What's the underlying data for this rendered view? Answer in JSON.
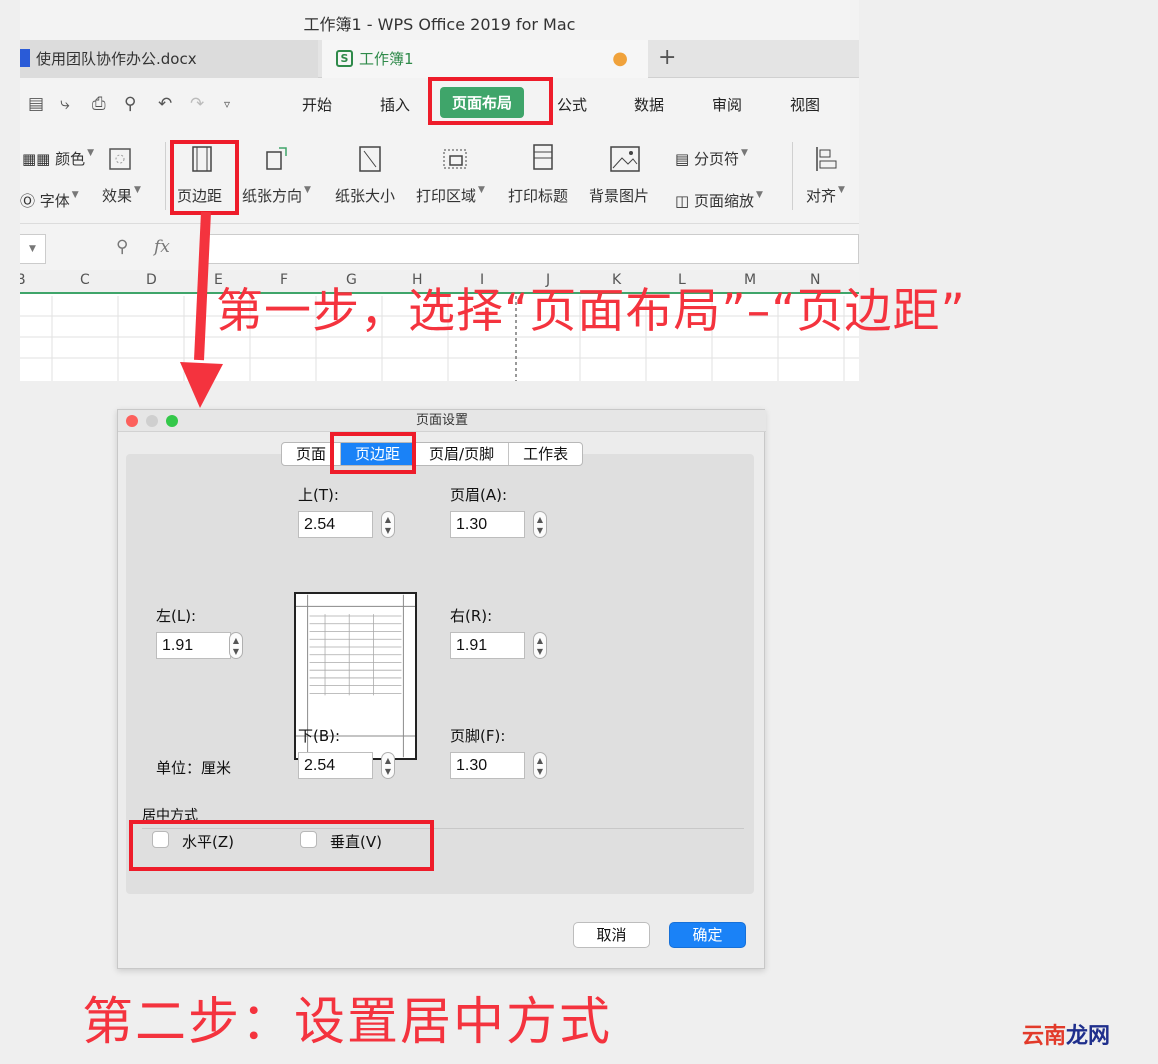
{
  "window": {
    "title": "工作簿1 - WPS Office 2019 for Mac",
    "tabs": [
      {
        "label": "使用团队协作办公.docx"
      },
      {
        "label": "工作簿1",
        "icon": "S",
        "modified_dot": "●"
      }
    ],
    "new_tab": "+"
  },
  "menu": {
    "items": [
      "开始",
      "插入",
      "页面布局",
      "公式",
      "数据",
      "审阅",
      "视图"
    ],
    "active": "页面布局"
  },
  "ribbon": {
    "color": "颜色",
    "font": "字体",
    "effect": "效果",
    "margins": "页边距",
    "orientation": "纸张方向",
    "size": "纸张大小",
    "print_area": "打印区域",
    "print_titles": "打印标题",
    "background": "背景图片",
    "page_break": "分页符",
    "page_zoom": "页面缩放",
    "align": "对齐"
  },
  "formula_bar": {
    "fx": "fx"
  },
  "grid": {
    "columns": [
      "B",
      "C",
      "D",
      "E",
      "F",
      "G",
      "H",
      "I",
      "J",
      "K",
      "L",
      "M",
      "N"
    ]
  },
  "steps": {
    "step1": "第一步，选择“页面布局”–“页边距”",
    "step2": "第二步：设置居中方式"
  },
  "dialog": {
    "title": "页面设置",
    "tabs": [
      "页面",
      "页边距",
      "页眉/页脚",
      "工作表"
    ],
    "selected_tab": "页边距",
    "top_label": "上(T):",
    "top": "2.54",
    "header_label": "页眉(A):",
    "header": "1.30",
    "left_label": "左(L):",
    "left": "1.91",
    "right_label": "右(R):",
    "right": "1.91",
    "bottom_label": "下(B):",
    "bottom": "2.54",
    "footer_label": "页脚(F):",
    "footer": "1.30",
    "unit": "单位：厘米",
    "center_title": "居中方式",
    "horizontal": "水平(Z)",
    "vertical": "垂直(V)",
    "cancel": "取消",
    "ok": "确定"
  },
  "watermark": {
    "part1": "云南",
    "part2": "龙网"
  },
  "colors": {
    "accent_green": "#3fa56a",
    "highlight_red": "#ee1c2a",
    "caption_red": "#f4333e",
    "mac_blue": "#1a82f7"
  }
}
